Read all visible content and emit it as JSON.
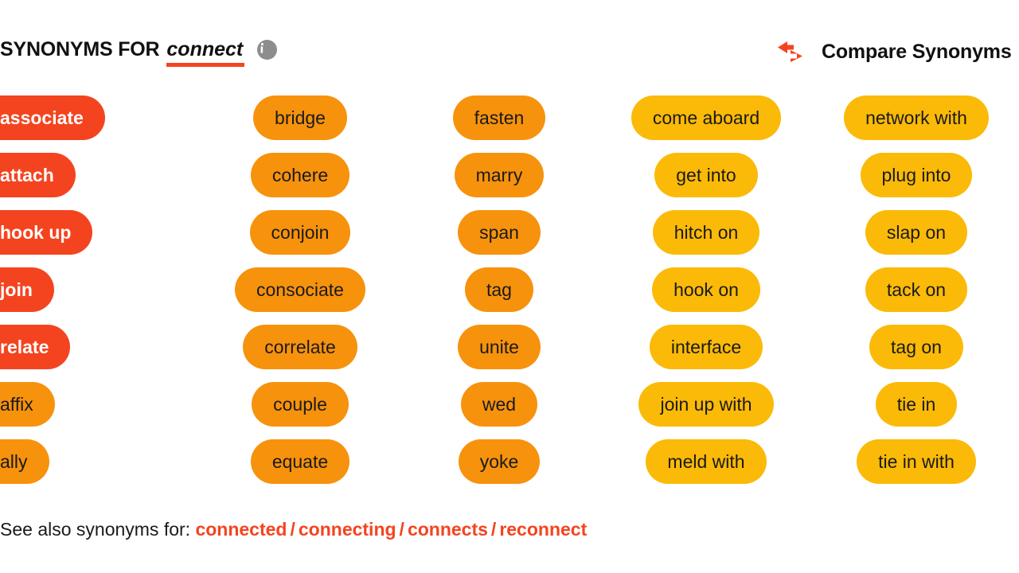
{
  "header": {
    "title_prefix": "SYNONYMS FOR",
    "headword": "connect",
    "info_icon": "info-icon",
    "compare_icon": "compare-arrows-icon",
    "compare_label": "Compare Synonyms"
  },
  "colors": {
    "tier_strong": "#f4441f",
    "tier_medium": "#f7920d",
    "tier_light": "#fbba07",
    "text_dark": "#1a1a1a",
    "text_light": "#ffffff",
    "info_icon_bg": "#8d8d8d",
    "background": "#ffffff"
  },
  "columns": [
    {
      "index": 1,
      "items": [
        {
          "label": "associate",
          "tier": "t-red"
        },
        {
          "label": "attach",
          "tier": "t-red"
        },
        {
          "label": "hook up",
          "tier": "t-red"
        },
        {
          "label": "join",
          "tier": "t-red"
        },
        {
          "label": "relate",
          "tier": "t-red"
        },
        {
          "label": "affix",
          "tier": "t-orange"
        },
        {
          "label": "ally",
          "tier": "t-orange"
        }
      ]
    },
    {
      "index": 2,
      "items": [
        {
          "label": "bridge",
          "tier": "t-orange"
        },
        {
          "label": "cohere",
          "tier": "t-orange"
        },
        {
          "label": "conjoin",
          "tier": "t-orange"
        },
        {
          "label": "consociate",
          "tier": "t-orange"
        },
        {
          "label": "correlate",
          "tier": "t-orange"
        },
        {
          "label": "couple",
          "tier": "t-orange"
        },
        {
          "label": "equate",
          "tier": "t-orange"
        }
      ]
    },
    {
      "index": 3,
      "items": [
        {
          "label": "fasten",
          "tier": "t-orange"
        },
        {
          "label": "marry",
          "tier": "t-orange"
        },
        {
          "label": "span",
          "tier": "t-orange"
        },
        {
          "label": "tag",
          "tier": "t-orange"
        },
        {
          "label": "unite",
          "tier": "t-orange"
        },
        {
          "label": "wed",
          "tier": "t-orange"
        },
        {
          "label": "yoke",
          "tier": "t-orange"
        }
      ]
    },
    {
      "index": 4,
      "items": [
        {
          "label": "come aboard",
          "tier": "t-amber"
        },
        {
          "label": "get into",
          "tier": "t-amber"
        },
        {
          "label": "hitch on",
          "tier": "t-amber"
        },
        {
          "label": "hook on",
          "tier": "t-amber"
        },
        {
          "label": "interface",
          "tier": "t-amber"
        },
        {
          "label": "join up with",
          "tier": "t-amber"
        },
        {
          "label": "meld with",
          "tier": "t-amber"
        }
      ]
    },
    {
      "index": 5,
      "items": [
        {
          "label": "network with",
          "tier": "t-amber"
        },
        {
          "label": "plug into",
          "tier": "t-amber"
        },
        {
          "label": "slap on",
          "tier": "t-amber"
        },
        {
          "label": "tack on",
          "tier": "t-amber"
        },
        {
          "label": "tag on",
          "tier": "t-amber"
        },
        {
          "label": "tie in",
          "tier": "t-amber"
        },
        {
          "label": "tie in with",
          "tier": "t-amber"
        }
      ]
    }
  ],
  "footer": {
    "label": "See also synonyms for:",
    "separator": "/",
    "links": [
      "connected",
      "connecting",
      "connects",
      "reconnect"
    ]
  }
}
